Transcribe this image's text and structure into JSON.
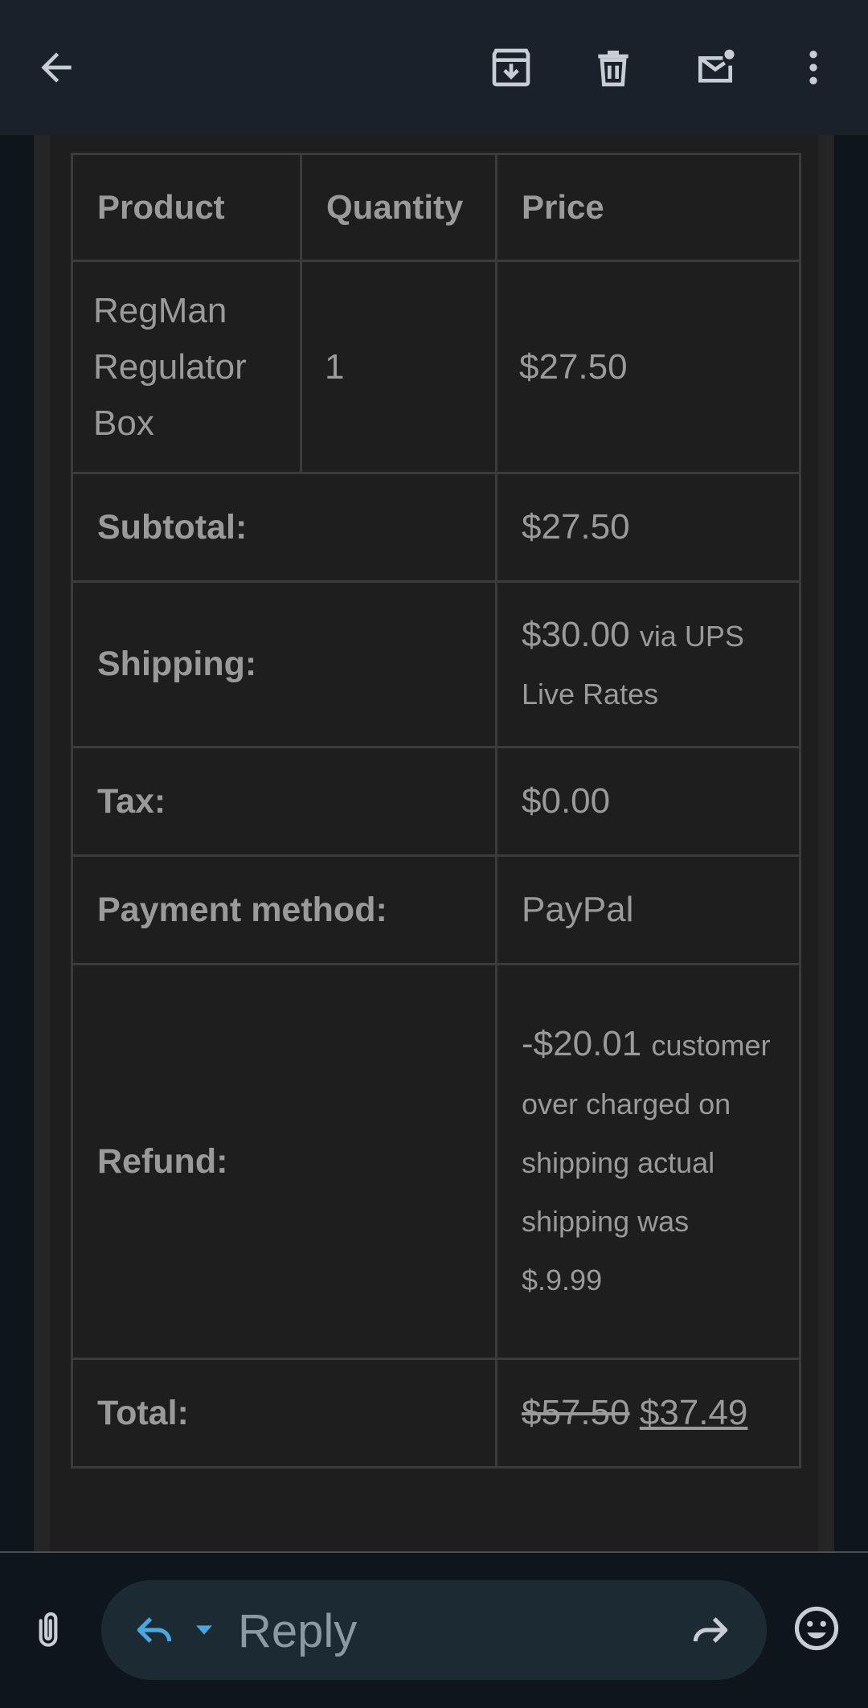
{
  "toolbar": {
    "back_icon": "arrow-left-icon",
    "archive_icon": "archive-icon",
    "delete_icon": "trash-icon",
    "mark_unread_icon": "mail-unread-icon",
    "more_icon": "more-vert-icon"
  },
  "order_table": {
    "headers": [
      "Product",
      "Quantity",
      "Price"
    ],
    "item": {
      "product": "RegMan Regulator Box",
      "quantity": "1",
      "price": "$27.50"
    },
    "subtotal": {
      "label": "Subtotal:",
      "value": "$27.50"
    },
    "shipping": {
      "label": "Shipping:",
      "value": "$30.00",
      "note": "via UPS Live Rates"
    },
    "tax": {
      "label": "Tax:",
      "value": "$0.00"
    },
    "payment": {
      "label": "Payment method:",
      "value": "PayPal"
    },
    "refund": {
      "label": "Refund:",
      "value": "-$20.01",
      "note": "customer over charged on shipping actual shipping was $.9.99"
    },
    "total": {
      "label": "Total:",
      "old_value": "$57.50",
      "new_value": "$37.49"
    }
  },
  "reply_bar": {
    "attach_icon": "paperclip-icon",
    "reply_label": "Reply",
    "emoji_icon": "emoji-icon",
    "forward_icon": "forward-icon"
  },
  "colors": {
    "topbar": "#1b212a",
    "background": "#0f161b",
    "table_bg": "#1e1e1e",
    "reply_pill": "#1b2a33",
    "accent": "#4aa8e0"
  }
}
